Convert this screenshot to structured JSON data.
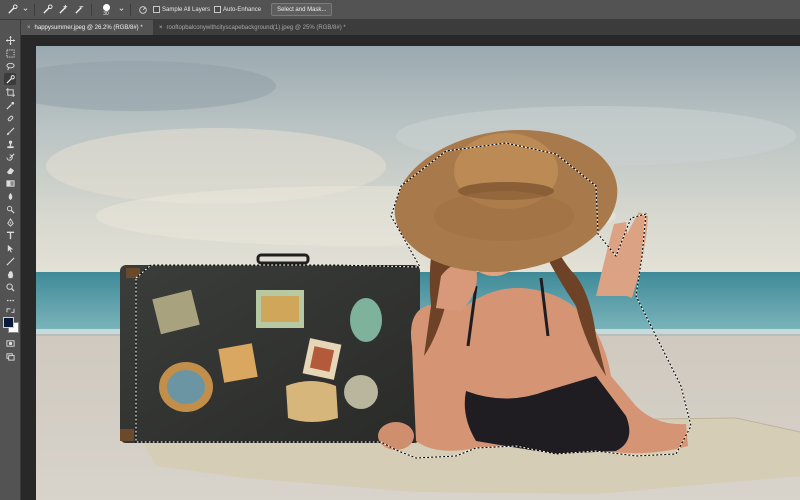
{
  "options": {
    "brush_size": "30",
    "sample_all_layers": "Sample All Layers",
    "auto_enhance": "Auto-Enhance",
    "select_and_mask": "Select and Mask..."
  },
  "tabs": [
    {
      "label": "happysummer.jpeg @ 26.2% (RGB/8#) *",
      "close": "×"
    },
    {
      "label": "rooftopbalconywithcityscapebackground(1).jpeg @ 25% (RGB/8#) *",
      "close": "×"
    }
  ],
  "colors": {
    "panel": "#535353",
    "dark": "#282828",
    "foreground_swatch": "#0b1a3a",
    "background_swatch": "#ffffff"
  }
}
